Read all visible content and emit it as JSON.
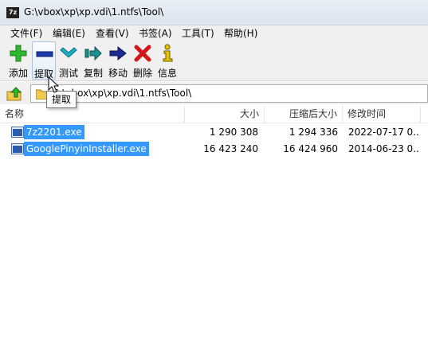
{
  "window": {
    "app_icon_text": "7z",
    "title": "G:\\vbox\\xp\\xp.vdi\\1.ntfs\\Tool\\"
  },
  "menu": {
    "items": [
      "文件(F)",
      "编辑(E)",
      "查看(V)",
      "书签(A)",
      "工具(T)",
      "帮助(H)"
    ]
  },
  "toolbar": {
    "add": "添加",
    "extract": "提取",
    "test": "测试",
    "copy": "复制",
    "move": "移动",
    "delete": "删除",
    "info": "信息"
  },
  "address": {
    "path": "G:\\vbox\\xp\\xp.vdi\\1.ntfs\\Tool\\"
  },
  "tooltip": {
    "text": "提取"
  },
  "columns": {
    "name": "名称",
    "size": "大小",
    "packed": "压缩后大小",
    "modified": "修改时间"
  },
  "files": [
    {
      "name": "7z2201.exe",
      "size": "1 290 308",
      "packed": "1 294 336",
      "modified": "2022-07-17 0..."
    },
    {
      "name": "GooglePinyinInstaller.exe",
      "size": "16 423 240",
      "packed": "16 424 960",
      "modified": "2014-06-23 0..."
    }
  ],
  "colors": {
    "selection": "#3399ff",
    "add_icon": "#2db82d",
    "extract_icon": "#1c3aa9",
    "test_icon": "#18b0c8",
    "copy_icon": "#1a8f8f",
    "move_icon": "#1a2a8f",
    "delete_icon": "#d4161b",
    "info_icon": "#e8c400"
  },
  "icons": {
    "add": "plus-icon",
    "extract": "minus-icon",
    "test": "check-chevron-icon",
    "copy": "copy-arrow-icon",
    "move": "move-arrow-icon",
    "delete": "x-icon",
    "info": "info-icon",
    "up": "up-folder-icon",
    "folder": "folder-icon",
    "file": "exe-file-icon"
  }
}
